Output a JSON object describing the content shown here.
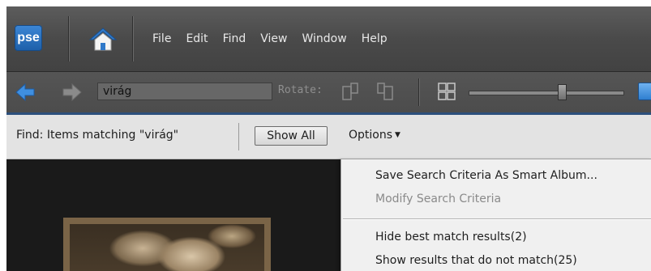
{
  "app": {
    "logo_text": "pse"
  },
  "menu": {
    "items": [
      "File",
      "Edit",
      "Find",
      "View",
      "Window",
      "Help"
    ]
  },
  "toolbar": {
    "search_value": "virág",
    "rotate_label": "Rotate:",
    "thumbnail_size_level": 0.63,
    "accent_color": "#2c4f7c"
  },
  "findbar": {
    "find_text": "Find: Items matching \"virág\"",
    "show_all_label": "Show All",
    "options_label": "Options"
  },
  "options_menu": {
    "items": [
      {
        "label": "Save Search Criteria As Smart Album...",
        "enabled": true
      },
      {
        "label": "Modify Search Criteria",
        "enabled": false
      },
      {
        "label": "Hide best match results(2)",
        "enabled": true
      },
      {
        "label": "Show results that do not match(25)",
        "enabled": true
      }
    ]
  },
  "icons": [
    "home-icon",
    "back-arrow-icon",
    "forward-arrow-icon",
    "rotate-left-icon",
    "rotate-right-icon",
    "grid-view-icon",
    "single-view-icon"
  ]
}
